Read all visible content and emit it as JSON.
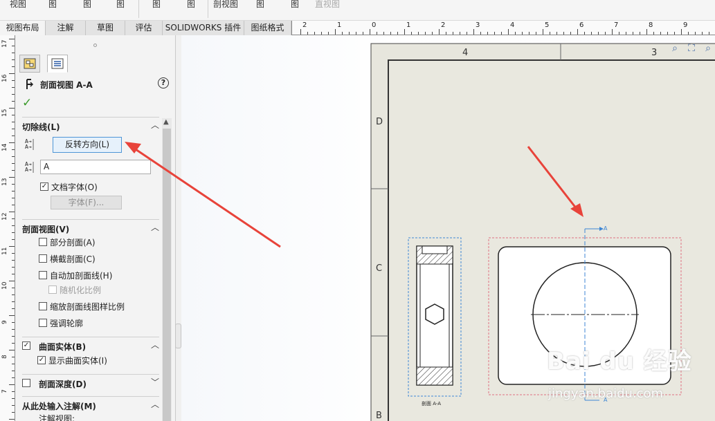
{
  "toolbar": {
    "items": [
      "视图",
      "图",
      "图",
      "图",
      "图",
      "图",
      "剖视图",
      "图",
      "图",
      "直视图"
    ]
  },
  "tabs": [
    {
      "label": "视图布局",
      "active": true
    },
    {
      "label": "注解",
      "active": false
    },
    {
      "label": "草图",
      "active": false
    },
    {
      "label": "评估",
      "active": false
    },
    {
      "label": "SOLIDWORKS 插件",
      "active": false
    },
    {
      "label": "图纸格式",
      "active": false
    }
  ],
  "h_ruler_labels": [
    "2",
    "1",
    "0",
    "1",
    "2",
    "3",
    "4",
    "5",
    "6",
    "7",
    "8",
    "9"
  ],
  "v_ruler_labels": [
    "17",
    "16",
    "15",
    "14",
    "13",
    "12",
    "11",
    "10",
    "9",
    "8",
    "7"
  ],
  "property_manager": {
    "title": "剖面视图 A-A",
    "help": "?",
    "ok": "✓",
    "cutting_line": {
      "heading": "切除线(L)",
      "flip_button": "反转方向(L)",
      "label_value": "A",
      "doc_font_label": "文档字体(O)",
      "doc_font_checked": true,
      "font_button": "字体(F)..."
    },
    "section_view": {
      "heading": "剖面视图(V)",
      "options": [
        {
          "label": "部分剖面(A)",
          "checked": false,
          "disabled": false
        },
        {
          "label": "横截剖面(C)",
          "checked": false,
          "disabled": false
        },
        {
          "label": "自动加剖面线(H)",
          "checked": false,
          "disabled": false
        },
        {
          "label": "随机化比例",
          "checked": false,
          "disabled": true
        },
        {
          "label": "缩放剖面线图样比例",
          "checked": false,
          "disabled": false
        },
        {
          "label": "强调轮廓",
          "checked": false,
          "disabled": false
        }
      ]
    },
    "surface_bodies": {
      "heading": "曲面实体(B)",
      "checked": true,
      "show_label": "显示曲面实体(I)",
      "show_checked": true
    },
    "section_depth": {
      "heading": "剖面深度(D)",
      "checked": false
    },
    "import_annotations": {
      "heading": "从此处输入注解(M)",
      "sub": "注解视图:"
    }
  },
  "drawing": {
    "zone_cols": [
      "4",
      "3"
    ],
    "zone_rows": [
      "D",
      "C",
      "B"
    ],
    "section_label": "剖面 A-A",
    "cut_letter_top": "A",
    "cut_letter_bottom": "A"
  },
  "watermark": {
    "main": "Bai du 经验",
    "sub": "jingyan.baidu.com"
  },
  "colors": {
    "arrow": "#e8433a",
    "selection": "#3d86d4",
    "sheet": "#e8e7dd",
    "accent_check": "#3a9a2a"
  }
}
